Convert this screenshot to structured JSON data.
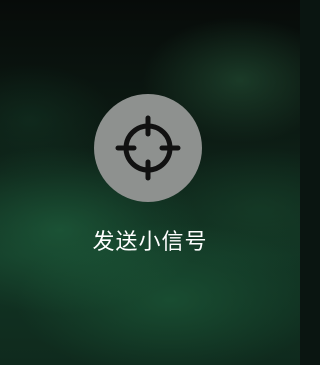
{
  "signal": {
    "icon": "crosshair-icon",
    "label": "发送小信号"
  },
  "colors": {
    "button_fill": "#8e918f",
    "icon_stroke": "#111111",
    "label_color": "#ffffff"
  }
}
